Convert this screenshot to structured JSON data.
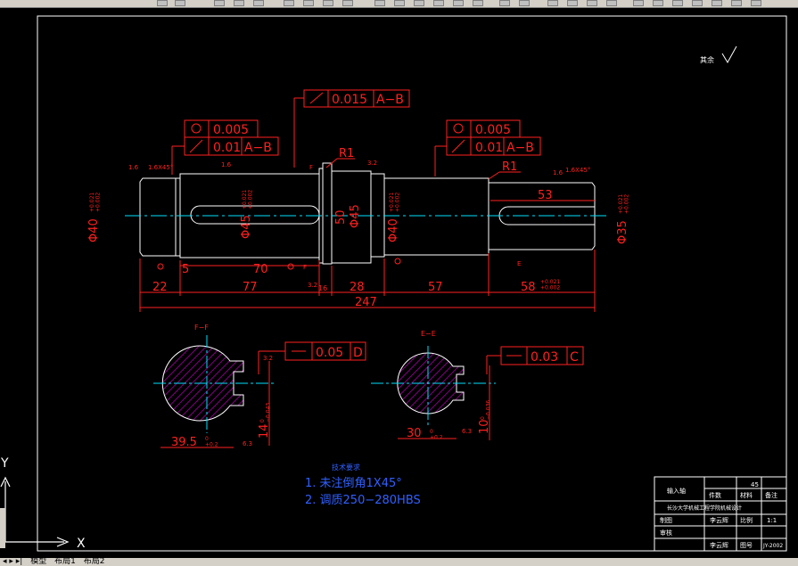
{
  "ucs": {
    "x_label": "X",
    "y_label": "Y"
  },
  "tabs": {
    "model": "模型",
    "layout1": "布局1",
    "layout2": "布局2"
  },
  "drawing": {
    "roughness_note": "其余",
    "gdt": {
      "top_runout": "0.015",
      "top_datum": "A−B",
      "left_cyl": "0.005",
      "left_runout": "0.01",
      "left_datum": "A−B",
      "right_cyl": "0.005",
      "right_runout": "0.01",
      "right_datum": "A−B",
      "section_f_sym": "0.05",
      "section_f_datum": "D",
      "section_e_sym": "0.03",
      "section_e_datum": "C"
    },
    "radius_labels": {
      "r_mid": "R1",
      "r_right": "R1"
    },
    "chamfer_labels": {
      "left": "1.6X45°",
      "right": "1.6X45°"
    },
    "roughness_values": {
      "r1": "1.6",
      "r2": "1.6",
      "r3": "3.2",
      "r4": "1.6",
      "r5": "3.2",
      "r6": "3.2",
      "r7": "6.3",
      "r8": "6.3"
    },
    "diameters": {
      "d40": "Φ40",
      "d40_tol": "+0.021\n+0.002",
      "d45": "Φ45",
      "d45_tol": "+0.021\n+0.002",
      "d50": "50",
      "d45b": "Φ45",
      "d40b": "Φ40",
      "d40b_tol": "+0.021\n+0.002",
      "d35": "Φ35",
      "d35_tol": "+0.021\n+0.002"
    },
    "lengths": {
      "l5": "5",
      "l70": "70",
      "l53": "53",
      "l22": "22",
      "l77": "77",
      "l16": "16",
      "l28": "28",
      "l57": "57",
      "l58": "58",
      "l58_tol": "+0.021\n+0.002",
      "l247": "247"
    },
    "section_labels": {
      "f": "F−F",
      "e": "E−E",
      "f_cut": "F",
      "e_cut": "E"
    },
    "section_dims": {
      "f_width": "39.5",
      "f_width_tol": "0\n+0.2",
      "f_key": "14",
      "f_key_tol": "0\n−0.043",
      "e_width": "30",
      "e_width_tol": "0\n+0.2",
      "e_key": "10",
      "e_key_tol": "0\n−0.036"
    },
    "tech_req": {
      "title": "技术要求",
      "item1": "1. 未注倒角1X45°",
      "item2": "2. 调质250−280HBS"
    },
    "title_block": {
      "school": "长沙大学机械工程学院机械设计",
      "part_name": "输入轴",
      "scale": "1:1",
      "material": "45",
      "drawn_by": "李云辉",
      "checked_by": "李云辉",
      "hdr1": "件数",
      "hdr2": "材料",
      "hdr3": "备注",
      "lbl_drawn": "制图",
      "lbl_check": "审核",
      "lbl_scale": "比例",
      "lbl_no": "图号",
      "drawing_no": "JY-2002"
    }
  }
}
